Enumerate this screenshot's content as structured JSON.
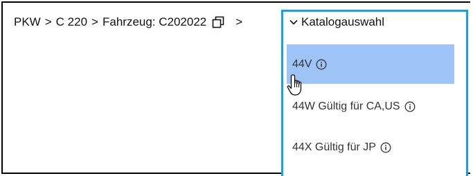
{
  "breadcrumb": {
    "items": [
      "PKW",
      "C 220",
      "Fahrzeug: C202022"
    ],
    "separator": ">"
  },
  "dropdown": {
    "label": "Katalogauswahl",
    "options": [
      {
        "label": "44V",
        "selected": true
      },
      {
        "label": "44W Gültig für CA,US",
        "selected": false
      },
      {
        "label": "44X Gültig für JP",
        "selected": false
      }
    ]
  },
  "colors": {
    "accent_border": "#18a0e6",
    "selected_bg": "#9ec4f7"
  },
  "icons": {
    "copy": "copy-icon",
    "chevron": "chevron-down-icon",
    "info": "info-icon",
    "cursor": "hand-pointer-icon"
  }
}
